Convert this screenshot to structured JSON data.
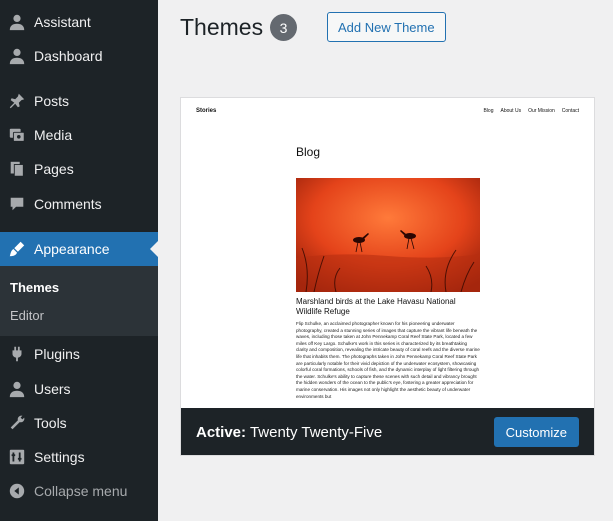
{
  "sidebar": {
    "items": [
      {
        "label": "Assistant",
        "icon": "user-icon"
      },
      {
        "label": "Dashboard",
        "icon": "dashboard-icon"
      },
      {
        "label": "Posts",
        "icon": "pin-icon"
      },
      {
        "label": "Media",
        "icon": "media-icon"
      },
      {
        "label": "Pages",
        "icon": "pages-icon"
      },
      {
        "label": "Comments",
        "icon": "comment-icon"
      },
      {
        "label": "Appearance",
        "icon": "brush-icon"
      },
      {
        "label": "Plugins",
        "icon": "plugin-icon"
      },
      {
        "label": "Users",
        "icon": "users-icon"
      },
      {
        "label": "Tools",
        "icon": "wrench-icon"
      },
      {
        "label": "Settings",
        "icon": "settings-icon"
      }
    ],
    "submenu": {
      "themes": "Themes",
      "editor": "Editor"
    },
    "collapse": "Collapse menu"
  },
  "header": {
    "title": "Themes",
    "count": "3",
    "add_new": "Add New Theme"
  },
  "theme_preview": {
    "site_title": "Stories",
    "nav": [
      "Blog",
      "About Us",
      "Our Mission",
      "Contact"
    ],
    "heading": "Blog",
    "post_title": "Marshland birds at the Lake Havasu National Wildlife Refuge",
    "post_body": "Flip Schulke, an acclaimed photographer known for his pioneering underwater photography, created a stunning series of images that capture the vibrant life beneath the waves, including those taken at John Pennekamp Coral Reef State Park, located a few miles off Key Largo. Schulke's work in this series is characterized by its breathtaking clarity and composition, revealing the intricate beauty of coral reefs and the diverse marine life that inhabits them. The photographs taken in John Pennekamp Coral Reef State Park are particularly notable for their vivid depiction of the underwater ecosystem, showcasing colorful coral formations, schools of fish, and the dynamic interplay of light filtering through the water. Schulke's ability to capture these scenes with such detail and vibrancy brought the hidden wonders of the ocean to the public's eye, fostering a greater appreciation for marine conservation. His images not only highlight the aesthetic beauty of underwater environments but"
  },
  "active_theme": {
    "prefix": "Active:",
    "name": "Twenty Twenty-Five",
    "customize": "Customize"
  },
  "colors": {
    "sidebar_bg": "#1d2327",
    "accent": "#2271b1",
    "badge": "#646970"
  }
}
